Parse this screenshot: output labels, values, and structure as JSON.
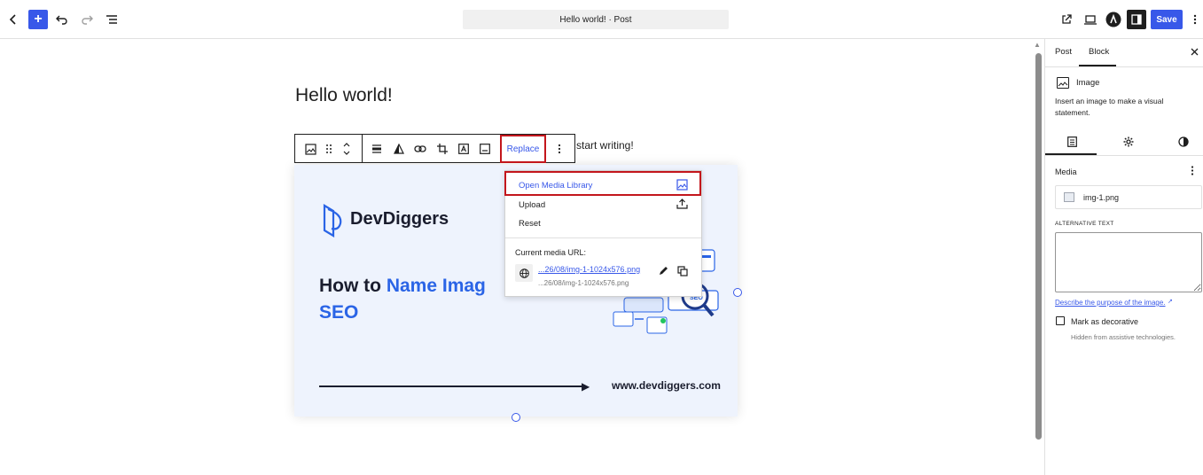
{
  "topbar": {
    "post_title": "Hello world! · Post",
    "save_label": "Save"
  },
  "editor": {
    "post_title": "Hello world!",
    "paragraph_fragment": "start writing!",
    "toolbar": {
      "replace_label": "Replace"
    }
  },
  "image": {
    "brand": "DevDiggers",
    "heading_part1": "How to ",
    "heading_part2": "Name Imag",
    "heading_line2": "SEO",
    "website": "www.devdiggers.com"
  },
  "replace_menu": {
    "open_media_library": "Open Media Library",
    "upload": "Upload",
    "reset": "Reset",
    "current_url_label": "Current media URL:",
    "url_link": "...26/08/img-1-1024x576.png",
    "url_sub": "...26/08/img-1-1024x576.png"
  },
  "sidebar": {
    "tabs": {
      "post": "Post",
      "block": "Block"
    },
    "block_name": "Image",
    "block_description": "Insert an image to make a visual statement.",
    "media_label": "Media",
    "media_filename": "img-1.png",
    "alt_text_label": "ALTERNATIVE TEXT",
    "alt_text_value": "",
    "alt_help_link": "Describe the purpose of the image.",
    "decorative_label": "Mark as decorative",
    "decorative_help": "Hidden from assistive technologies.",
    "decorative_checked": false
  },
  "colors": {
    "accent": "#3858e9",
    "highlight_border": "#c3161c",
    "image_bg": "#eef3fd",
    "heading_blue": "#2a64e6"
  }
}
